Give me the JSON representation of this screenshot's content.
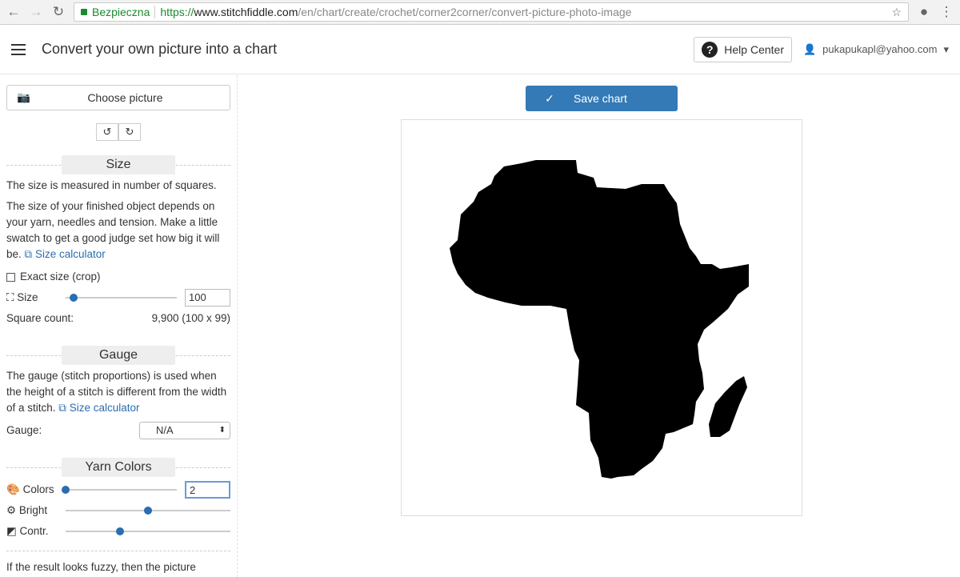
{
  "browser": {
    "secure_label": "Bezpieczna",
    "url_scheme": "https://",
    "url_host": "www.stitchfiddle.com",
    "url_path": "/en/chart/create/crochet/corner2corner/convert-picture-photo-image"
  },
  "header": {
    "title": "Convert your own picture into a chart",
    "help_label": "Help Center",
    "user": "pukapukapl@yahoo.com"
  },
  "sidebar": {
    "choose_picture": "Choose picture",
    "size": {
      "heading": "Size",
      "text1": "The size is measured in number of squares.",
      "text2": "The size of your finished object depends on your yarn, needles and tension. Make a little swatch to get a good judge set how big it will be.",
      "link": "Size calculator",
      "exact_label": "Exact size (crop)",
      "exact_checked": false,
      "size_label": "Size",
      "size_value": "100",
      "size_slider_fraction": 0.07,
      "count_label": "Square count:",
      "count_value": "9,900 (100 x 99)"
    },
    "gauge": {
      "heading": "Gauge",
      "text": "The gauge (stitch proportions) is used when the height of a stitch is different from the width of a stitch.",
      "link": "Size calculator",
      "label": "Gauge:",
      "value": "N/A"
    },
    "yarn": {
      "heading": "Yarn Colors",
      "colors_label": "Colors",
      "colors_value": "2",
      "colors_slider_fraction": 0.0,
      "bright_label": "Bright",
      "bright_slider_fraction": 0.5,
      "contr_label": "Contr.",
      "contr_slider_fraction": 0.33
    },
    "footer_text": "If the result looks fuzzy, then the picture"
  },
  "main": {
    "save_label": "Save chart"
  },
  "colors": {
    "accent": "#337ab7",
    "secure": "#1a8b2d"
  }
}
